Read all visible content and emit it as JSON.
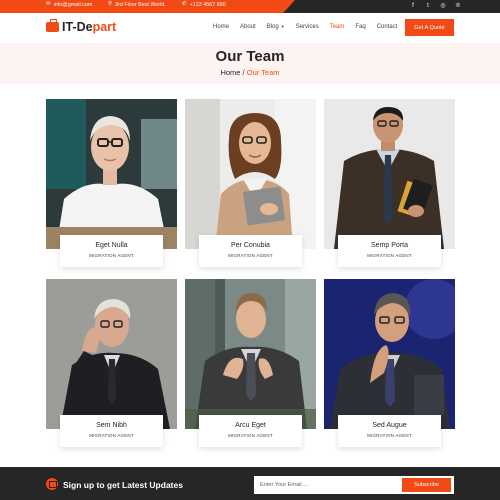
{
  "topbar": {
    "email": "info@gmail.com",
    "address": "3rd Floor Best World.",
    "phone": "+123 4567 890",
    "email_icon": "✉",
    "address_icon": "⚲",
    "phone_icon": "✆",
    "social": [
      {
        "icon": "facebook-icon",
        "glyph": "f"
      },
      {
        "icon": "twitter-icon",
        "glyph": "t"
      },
      {
        "icon": "instagram-icon",
        "glyph": "◎"
      },
      {
        "icon": "pinterest-icon",
        "glyph": "℗"
      }
    ]
  },
  "brand": {
    "part1": "IT-De",
    "part2": "part",
    "icon": "briefcase-icon"
  },
  "nav": {
    "home": "Home",
    "about": "About",
    "blog": "Blog",
    "blog_caret": "▼",
    "services": "Services",
    "team": "Team",
    "faq": "Faq",
    "contact": "Contact",
    "quote_button": "Get A Quote"
  },
  "page_header": {
    "title": "Our Team",
    "crumb_home": "Home",
    "crumb_sep": " / ",
    "crumb_current": "Our Team"
  },
  "team": [
    {
      "name": "Eget Nulla",
      "role": "MIGRATION AGENT"
    },
    {
      "name": "Per Conubia",
      "role": "MIGRATION AGENT"
    },
    {
      "name": "Semp Porta",
      "role": "MIGRATION AGENT"
    },
    {
      "name": "Sem Nibh",
      "role": "MIGRATION AGENT"
    },
    {
      "name": "Arcu Eget",
      "role": "MIGRATION AGENT"
    },
    {
      "name": "Sed Augue",
      "role": "MIGRATION AGENT"
    }
  ],
  "footer": {
    "signup_text": "Sign up to get Latest Updates",
    "email_placeholder": "Enter Your Email....",
    "subscribe_button": "Subscribe",
    "icon": "envelope-icon"
  },
  "colors": {
    "accent": "#f24a14",
    "dark": "#262626",
    "header_bg": "#fdf4f1"
  }
}
